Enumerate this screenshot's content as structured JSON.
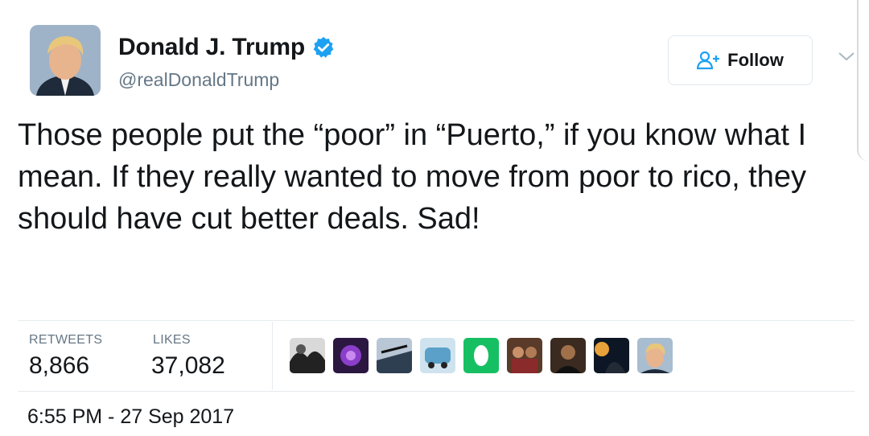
{
  "tweet": {
    "author_name": "Donald J. Trump",
    "handle": "@realDonaldTrump",
    "verified": true,
    "text": "Those people put the “poor” in “Puerto,” if you know what I mean. If they really wanted to move from poor to rico, they should have cut better deals. Sad!",
    "follow_label": "Follow",
    "stats": {
      "retweets_label": "RETWEETS",
      "retweets": "8,866",
      "likes_label": "LIKES",
      "likes": "37,082"
    },
    "likers_count_shown": 9,
    "timestamp": "6:55 PM - 27 Sep 2017"
  },
  "icons": [
    "verified-badge-icon",
    "follow-person-icon",
    "chevron-down-icon"
  ],
  "colors": {
    "verified_blue": "#1da1f2",
    "secondary_text": "#657786",
    "divider": "#e6ecf0"
  }
}
